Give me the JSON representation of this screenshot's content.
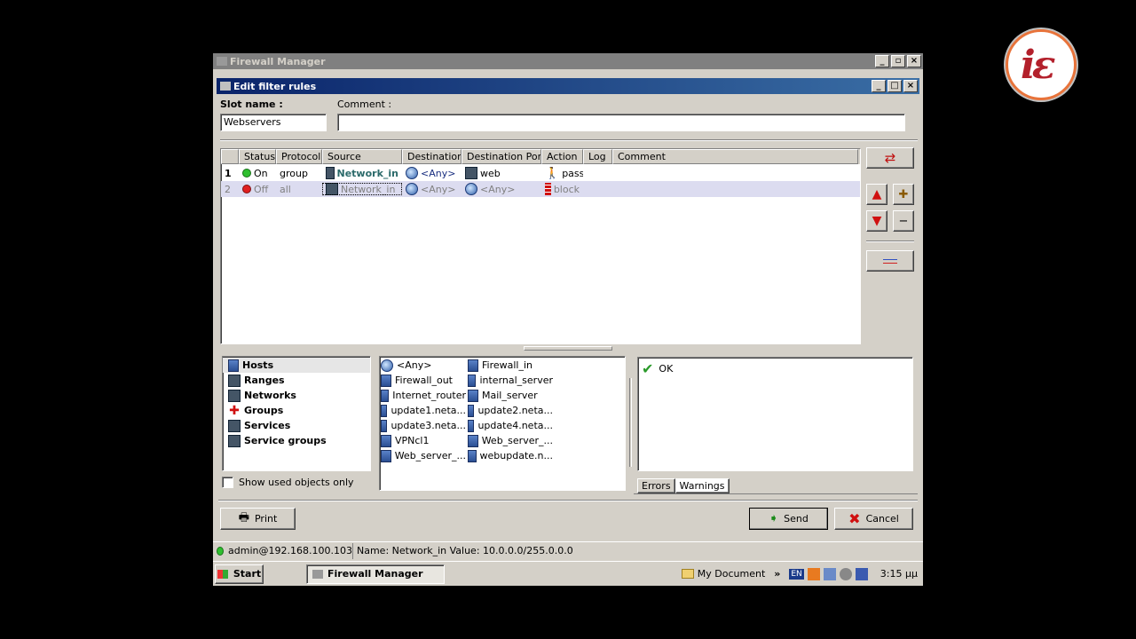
{
  "outer_window": {
    "title": "Firewall Manager"
  },
  "dialog": {
    "title": "Edit filter rules"
  },
  "slot": {
    "label": "Slot name :",
    "value": "Webservers"
  },
  "comment": {
    "label": "Comment :",
    "value": ""
  },
  "table": {
    "columns": [
      "Status",
      "Protocol",
      "Source",
      "Destination",
      "Destination Port",
      "Action",
      "Log",
      "Comment"
    ],
    "rows": [
      {
        "num": "1",
        "status": "On",
        "status_color": "#2fbf2f",
        "protocol": "group",
        "source": "Network_in",
        "destination": "<Any>",
        "port": "web",
        "action": "pass",
        "log": "",
        "comment": ""
      },
      {
        "num": "2",
        "status": "Off",
        "status_color": "#e02020",
        "protocol": "all",
        "source": "Network_in",
        "destination": "<Any>",
        "port": "<Any>",
        "action": "block",
        "log": "",
        "comment": ""
      }
    ]
  },
  "categories": [
    "Hosts",
    "Ranges",
    "Networks",
    "Groups",
    "Services",
    "Service groups"
  ],
  "objects": [
    "<Any>",
    "Firewall_in",
    "Firewall_out",
    "internal_server",
    "Internet_router",
    "Mail_server",
    "update1.neta...",
    "update2.neta...",
    "update3.neta...",
    "update4.neta...",
    "VPNcl1",
    "Web_server_...",
    "Web_server_...",
    "webupdate.n..."
  ],
  "show_used": {
    "label": "Show used objects only",
    "checked": false
  },
  "messages": {
    "ok": "OK"
  },
  "tabs": [
    "Errors",
    "Warnings"
  ],
  "buttons": {
    "print": "Print",
    "send": "Send",
    "cancel": "Cancel"
  },
  "status": {
    "user": "admin@192.168.100.103",
    "info": "Name: Network_in Value: 10.0.0.0/255.0.0.0"
  },
  "taskbar": {
    "start": "Start",
    "task": "Firewall Manager",
    "mydoc": "My Document",
    "lang": "EN",
    "time": "3:15 μμ"
  },
  "logo": {
    "text": "iε"
  }
}
